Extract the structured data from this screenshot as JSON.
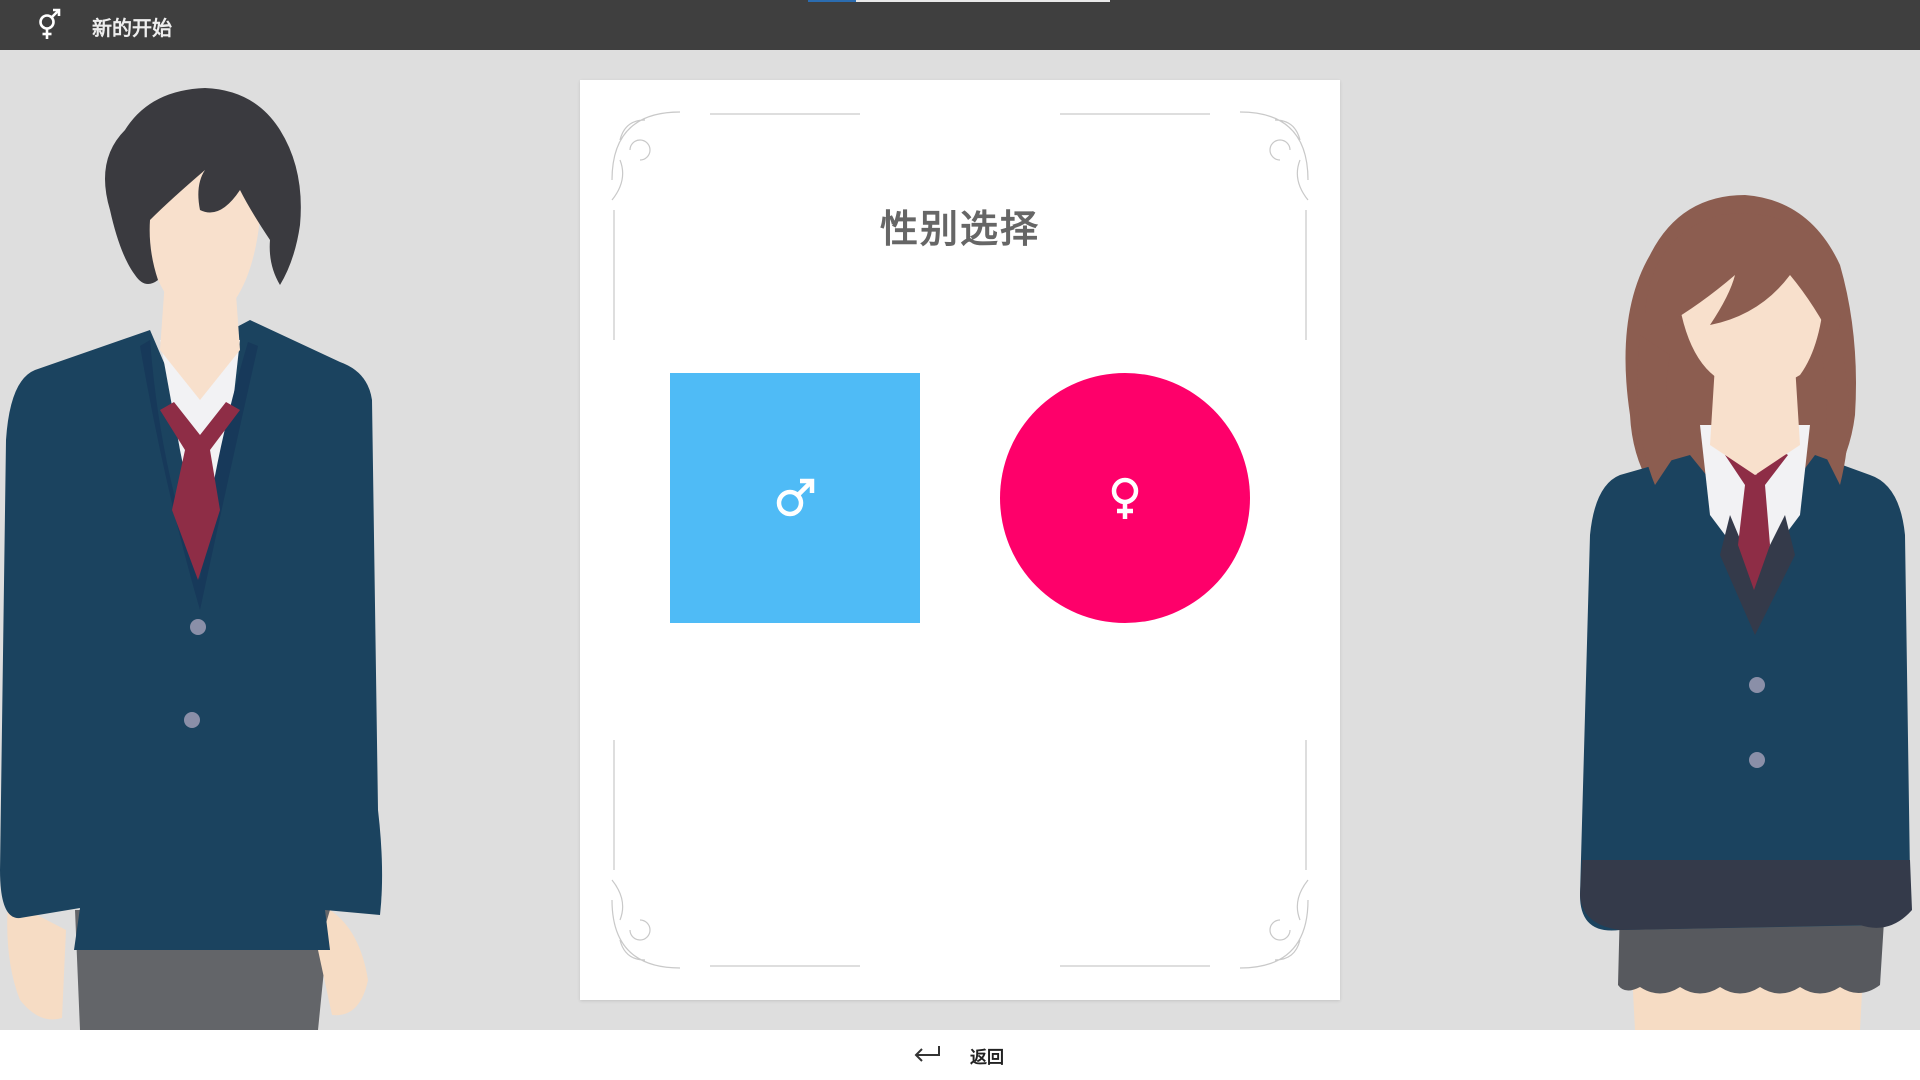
{
  "app": {
    "title": "新的开始",
    "logo_icon": "male-female-icon",
    "progress": 0.16
  },
  "card": {
    "heading": "性别选择",
    "options": [
      {
        "icon": "male-icon",
        "color": "#4fbbf6",
        "shape": "square"
      },
      {
        "icon": "female-icon",
        "color": "#fe006a",
        "shape": "circle"
      }
    ]
  },
  "footer": {
    "back_label": "返回",
    "back_icon": "return-arrow-icon"
  },
  "colors": {
    "topbar": "#3f3f3f",
    "background": "#dedede",
    "jacket": "#1b435f",
    "tie": "#8e2d46"
  }
}
